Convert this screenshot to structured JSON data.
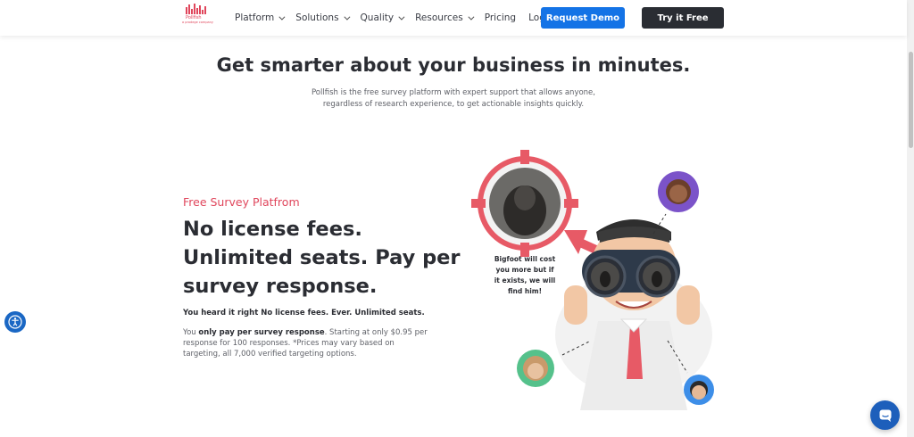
{
  "header": {
    "logo": {
      "name": "Pollfish",
      "sub": "a prodege company"
    },
    "nav": [
      {
        "label": "Platform",
        "has_menu": true
      },
      {
        "label": "Solutions",
        "has_menu": true
      },
      {
        "label": "Quality",
        "has_menu": true
      },
      {
        "label": "Resources",
        "has_menu": true
      },
      {
        "label": "Pricing",
        "has_menu": false
      },
      {
        "label": "Login",
        "has_menu": false
      }
    ],
    "request_demo": "Request Demo",
    "try_free": "Try it Free"
  },
  "hero": {
    "title": "Get smarter about your business in minutes.",
    "subtitle": "Pollfish is the free survey platform with expert support that allows anyone, regardless of research experience, to get actionable insights quickly."
  },
  "feature": {
    "eyebrow": "Free Survey Platfrom",
    "headline_lines": [
      "No license fees.",
      "Unlimited seats. Pay per",
      "survey response."
    ],
    "bold_line": "You heard it right No license fees. Ever. Unlimited seats.",
    "para_prefix": "You ",
    "para_bold": "only pay per survey response",
    "para_rest": ". Starting at only $0.95 per response for 100 responses. *Prices may vary based on targeting, all 7,000 verified targeting options."
  },
  "illustration": {
    "bubble_lines": [
      "Bigfoot will cost",
      "you more but if",
      "it exists, we will",
      "find him!"
    ]
  },
  "colors": {
    "accent": "#e0465c",
    "primary": "#1473e6",
    "dark": "#2a2d33"
  },
  "icons": {
    "accessibility": "accessibility-icon",
    "chat": "chat-icon"
  }
}
